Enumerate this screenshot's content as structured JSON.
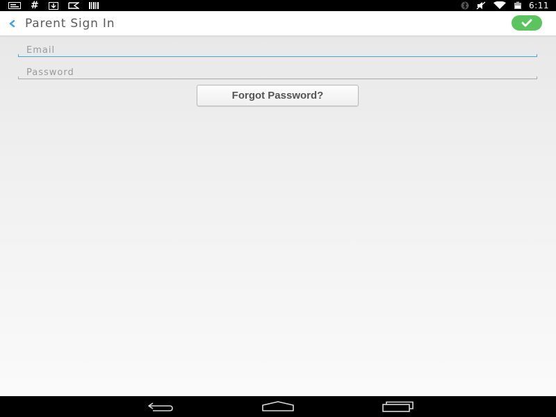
{
  "status_bar": {
    "left_icons": [
      "notification-message-icon",
      "hash-icon",
      "download-icon",
      "flag-icon",
      "barcode-icon"
    ],
    "hash_glyph": "#",
    "right_icons": [
      "bluetooth-icon",
      "mute-icon",
      "wifi-icon",
      "battery-icon"
    ],
    "time": "6:11"
  },
  "action_bar": {
    "title": "Parent Sign In",
    "back_icon": "chevron-left-icon",
    "confirm_icon": "checkmark-icon",
    "accent_color": "#4aa3d8",
    "confirm_color": "#5cc45f"
  },
  "form": {
    "email": {
      "placeholder": "Email",
      "value": ""
    },
    "password": {
      "placeholder": "Password",
      "value": ""
    },
    "forgot_label": "Forgot Password?"
  },
  "nav_bar": {
    "icons": [
      "nav-back-icon",
      "nav-home-icon",
      "nav-recents-icon"
    ]
  }
}
